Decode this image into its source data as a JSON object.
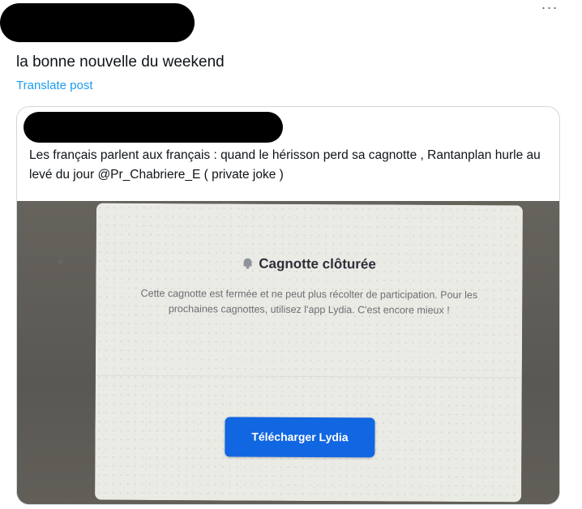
{
  "post": {
    "text": "la bonne nouvelle du weekend",
    "translate_label": "Translate post",
    "more_label": "···"
  },
  "quoted_post": {
    "text": "Les français parlent aux français : quand le hérisson perd sa cagnotte , Rantanplan hurle au levé du jour @Pr_Chabriere_E ( private joke )"
  },
  "photo_screen": {
    "title": "Cagnotte clôturée",
    "title_icon": "bell-icon",
    "message": "Cette cagnotte est fermée et ne peut plus récolter de participation. Pour les prochaines cagnottes, utilisez l'app Lydia. C'est encore mieux !",
    "button_label": "Télécharger Lydia",
    "button_color": "#1166e2"
  },
  "colors": {
    "link": "#1d9bf0",
    "text": "#0f1419",
    "border": "#cfd9de"
  }
}
